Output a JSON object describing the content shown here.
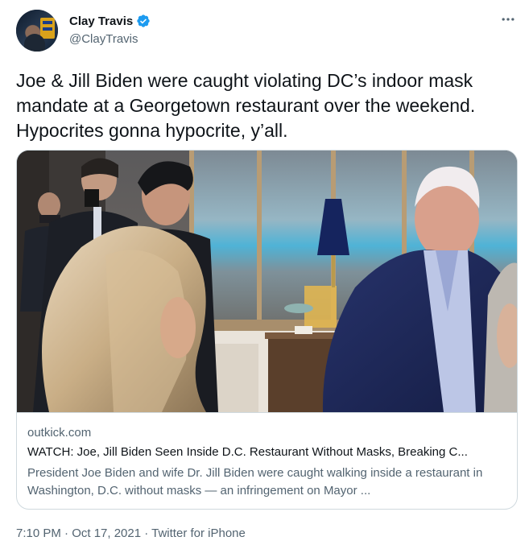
{
  "author": {
    "display_name": "Clay Travis",
    "handle": "@ClayTravis",
    "verified": true,
    "avatar_icon": "profile-photo"
  },
  "tweet": {
    "text": "Joe & Jill Biden were caught violating DC’s indoor mask mandate at a Georgetown restaurant over the weekend. Hypocrites gonna hypocrite, y’all."
  },
  "card": {
    "domain": "outkick.com",
    "title": "WATCH: Joe, Jill Biden Seen Inside D.C. Restaurant Without Masks, Breaking C...",
    "description": "President Joe Biden and wife Dr. Jill Biden were caught walking inside a restaurant in Washington, D.C. without masks — an infringement on Mayor ..."
  },
  "meta": {
    "timestamp": "7:10 PM · Oct 17, 2021 · Twitter for iPhone"
  },
  "colors": {
    "text_primary": "#0f1419",
    "text_secondary": "#536471",
    "verified_blue": "#1d9bf0",
    "border": "#cfd9de"
  }
}
